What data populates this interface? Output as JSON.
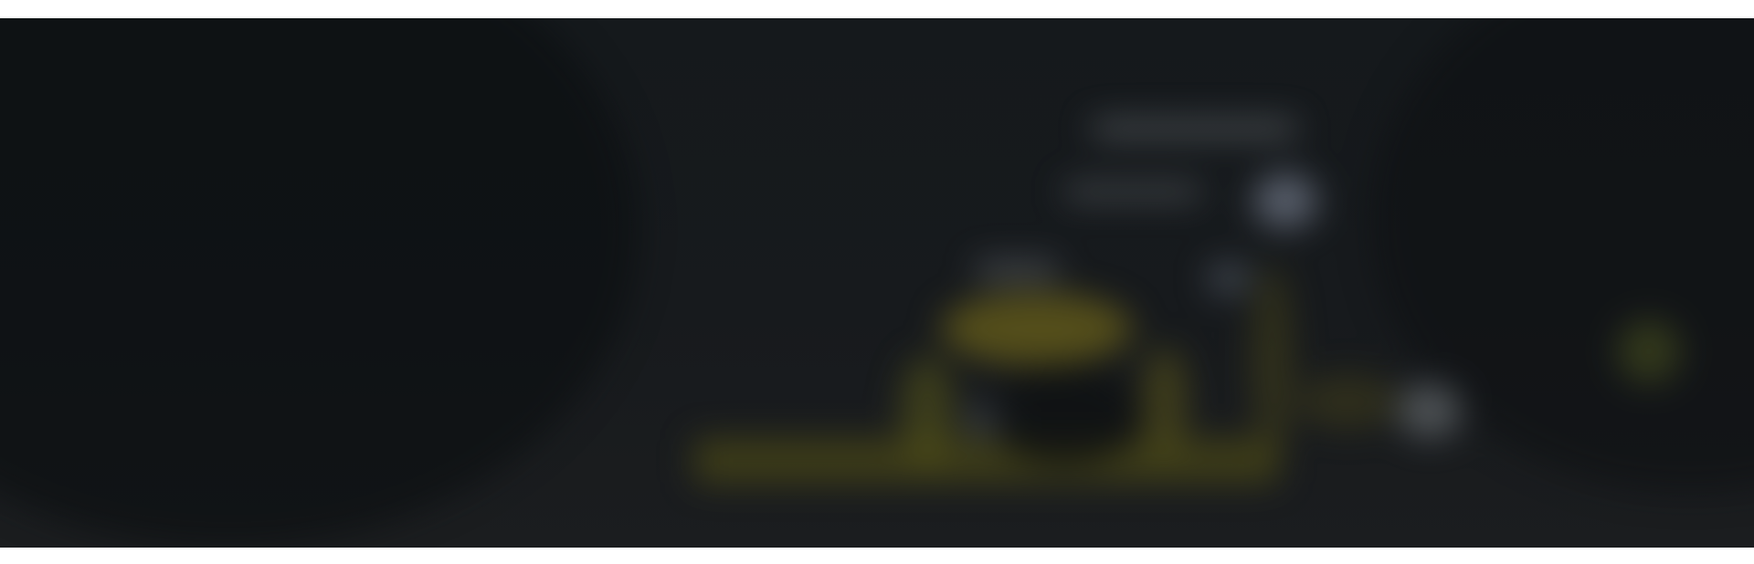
{
  "hero": {
    "accent_color": "#6b6a1e",
    "background_color": "#16191c"
  }
}
